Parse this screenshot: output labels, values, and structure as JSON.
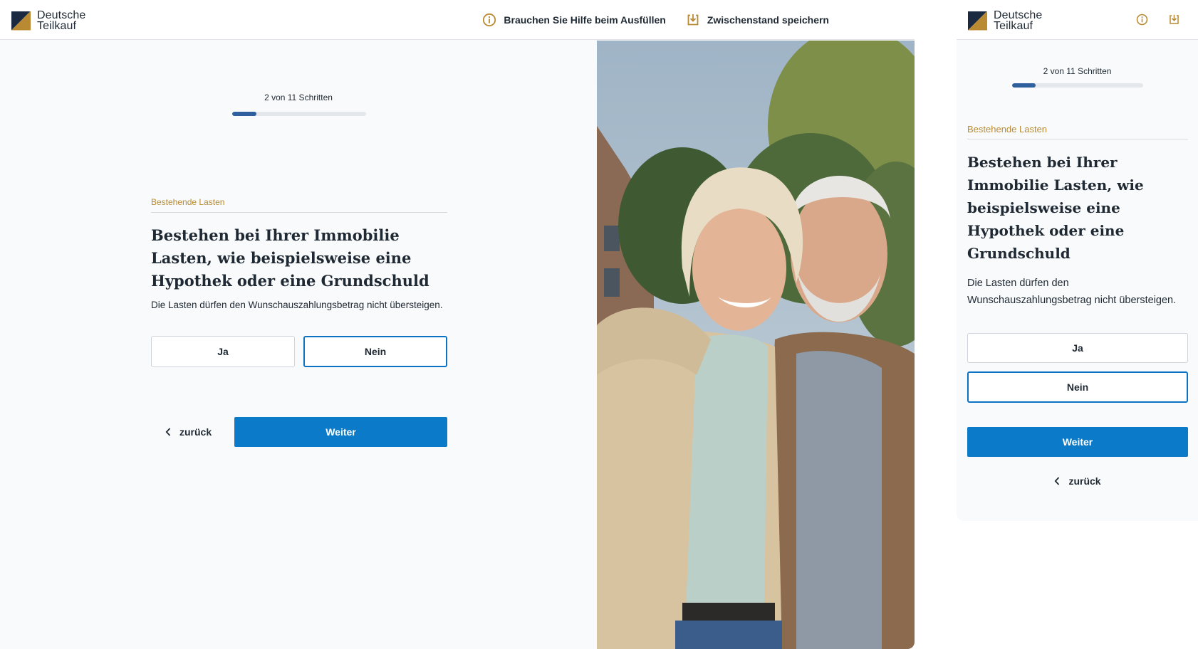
{
  "brand": {
    "name_line1": "Deutsche",
    "name_line2": "Teilkauf"
  },
  "header": {
    "help_label": "Brauchen Sie Hilfe beim Ausfüllen",
    "save_label": "Zwischenstand speichern",
    "icons": [
      "info-icon",
      "download-tray-icon"
    ]
  },
  "progress": {
    "label": "2 von 11 Schritten",
    "current_step": 2,
    "total_steps": 11,
    "fraction": 0.18
  },
  "question": {
    "eyebrow": "Bestehende Lasten",
    "title": "Bestehen bei Ihrer Immobilie Lasten, wie beispielsweise eine Hypothek oder eine Grundschuld",
    "subtitle": "Die Lasten dürfen den Wunschauszahlungsbetrag nicht übersteigen.",
    "options": [
      {
        "label": "Ja",
        "selected": false
      },
      {
        "label": "Nein",
        "selected": true
      }
    ]
  },
  "navigation": {
    "back_label": "zurück",
    "next_label": "Weiter"
  },
  "photo": {
    "subject": "smiling elderly couple embracing outdoors"
  },
  "colors": {
    "accent_gold": "#b98a32",
    "brand_navy": "#1b2a41",
    "primary_blue": "#0b7bc9",
    "progress_blue": "#2f5f9e"
  }
}
